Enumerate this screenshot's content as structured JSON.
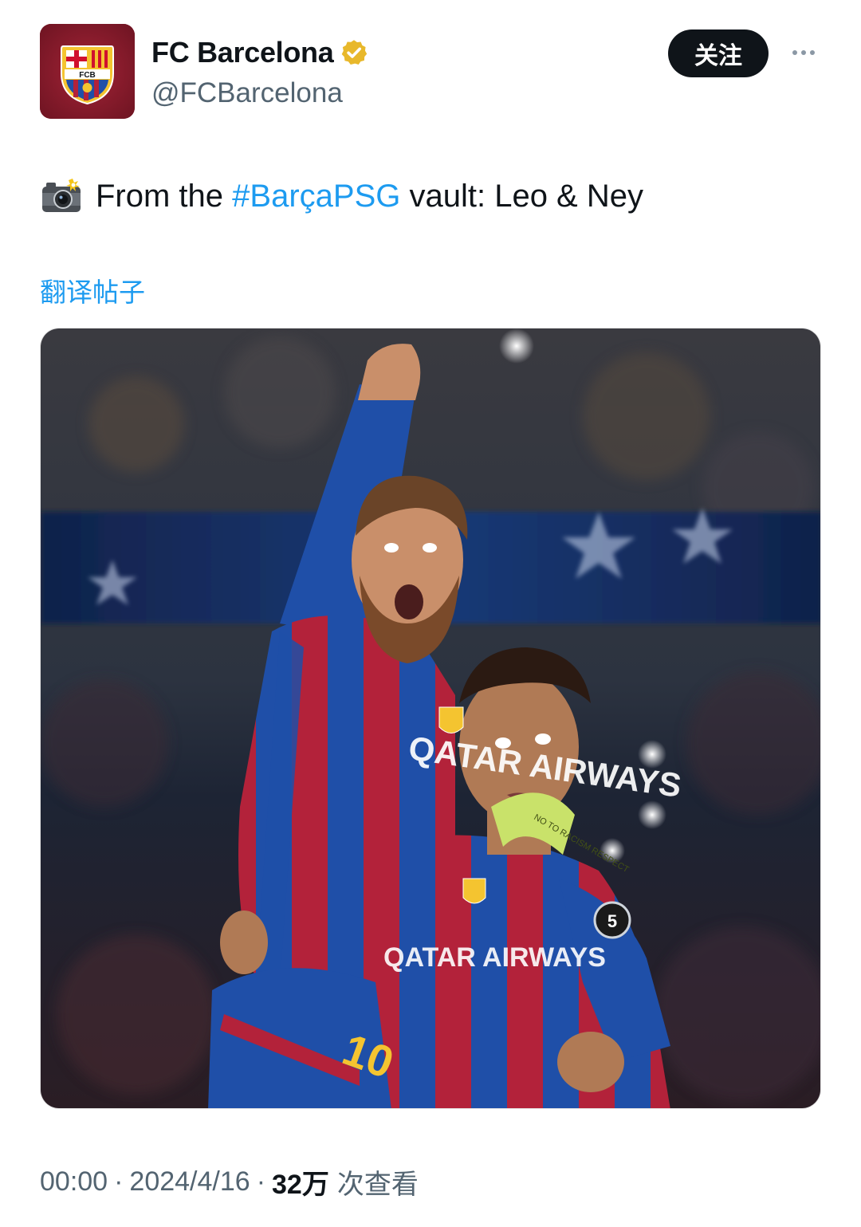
{
  "author": {
    "display_name": "FC Barcelona",
    "handle": "@FCBarcelona",
    "avatar_icon": "fcb-crest-icon",
    "avatar_text": "FCB",
    "verified_icon": "verified-badge-icon",
    "verified_color": "#e8b82b"
  },
  "actions": {
    "follow_label": "关注",
    "more_icon": "more-dots-icon"
  },
  "tweet": {
    "emoji_icon": "camera-flash-icon",
    "text_before": "From the ",
    "hashtag": "#BarçaPSG",
    "text_after": " vault: Leo & Ney",
    "translate_label": "翻译帖子"
  },
  "media": {
    "jersey_text_1": "QATAR AIRWAYS",
    "jersey_text_2": "QATAR AIRWAYS",
    "armband_text": "NO TO RACISM RESPECT",
    "shirt_number": "10",
    "badge_text": "5"
  },
  "meta": {
    "time": "00:00",
    "separator": "·",
    "date": "2024/4/16",
    "views_count": "32万",
    "views_label": "次查看"
  },
  "colors": {
    "link": "#1d9bf0",
    "secondary_text": "#536471",
    "button_bg": "#0f1419",
    "barca_blue": "#1f4fa8",
    "barca_red": "#b3223a"
  }
}
